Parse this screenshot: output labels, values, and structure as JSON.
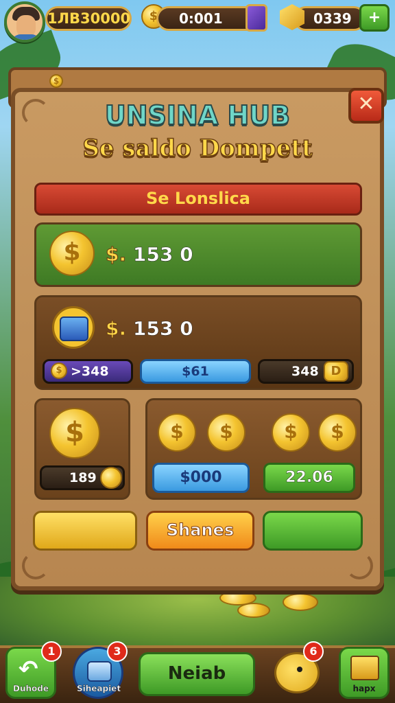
{
  "topbar": {
    "player_currency": "1ЛВ30000",
    "coins": "0:001",
    "gems": "0339",
    "plus_label": "+"
  },
  "panel": {
    "small_icon": "$",
    "title": "UNSINA HUB",
    "subtitle": "Se saldo Dompett",
    "banner": "Se Lonslica",
    "rows": [
      {
        "currency": "$.",
        "amount": "153 0",
        "icon": "dollar-coin-icon"
      },
      {
        "currency": "$.",
        "amount": "153 0",
        "icon": "treasure-chest-icon"
      }
    ],
    "chips": {
      "left": ">348",
      "middle": "$61",
      "right": "348",
      "right_icon": "D"
    },
    "lower_left": {
      "value": "189"
    },
    "lower_right": {
      "blue": "$000",
      "green": "22.06"
    },
    "buttons": {
      "left": "",
      "center": "Shanes",
      "right": ""
    },
    "close_label": "✕"
  },
  "bottom_nav": {
    "items": [
      {
        "label": "Duhode",
        "badge": "1"
      },
      {
        "label": "Siheapiet",
        "badge": "3"
      },
      {
        "label": "Neiab"
      },
      {
        "label": "",
        "badge": "6"
      },
      {
        "label": "hapx"
      }
    ]
  },
  "colors": {
    "panel": "#c99a62",
    "gold": "#f4c430",
    "accent_green": "#3e9a26",
    "accent_red": "#d84a34"
  }
}
